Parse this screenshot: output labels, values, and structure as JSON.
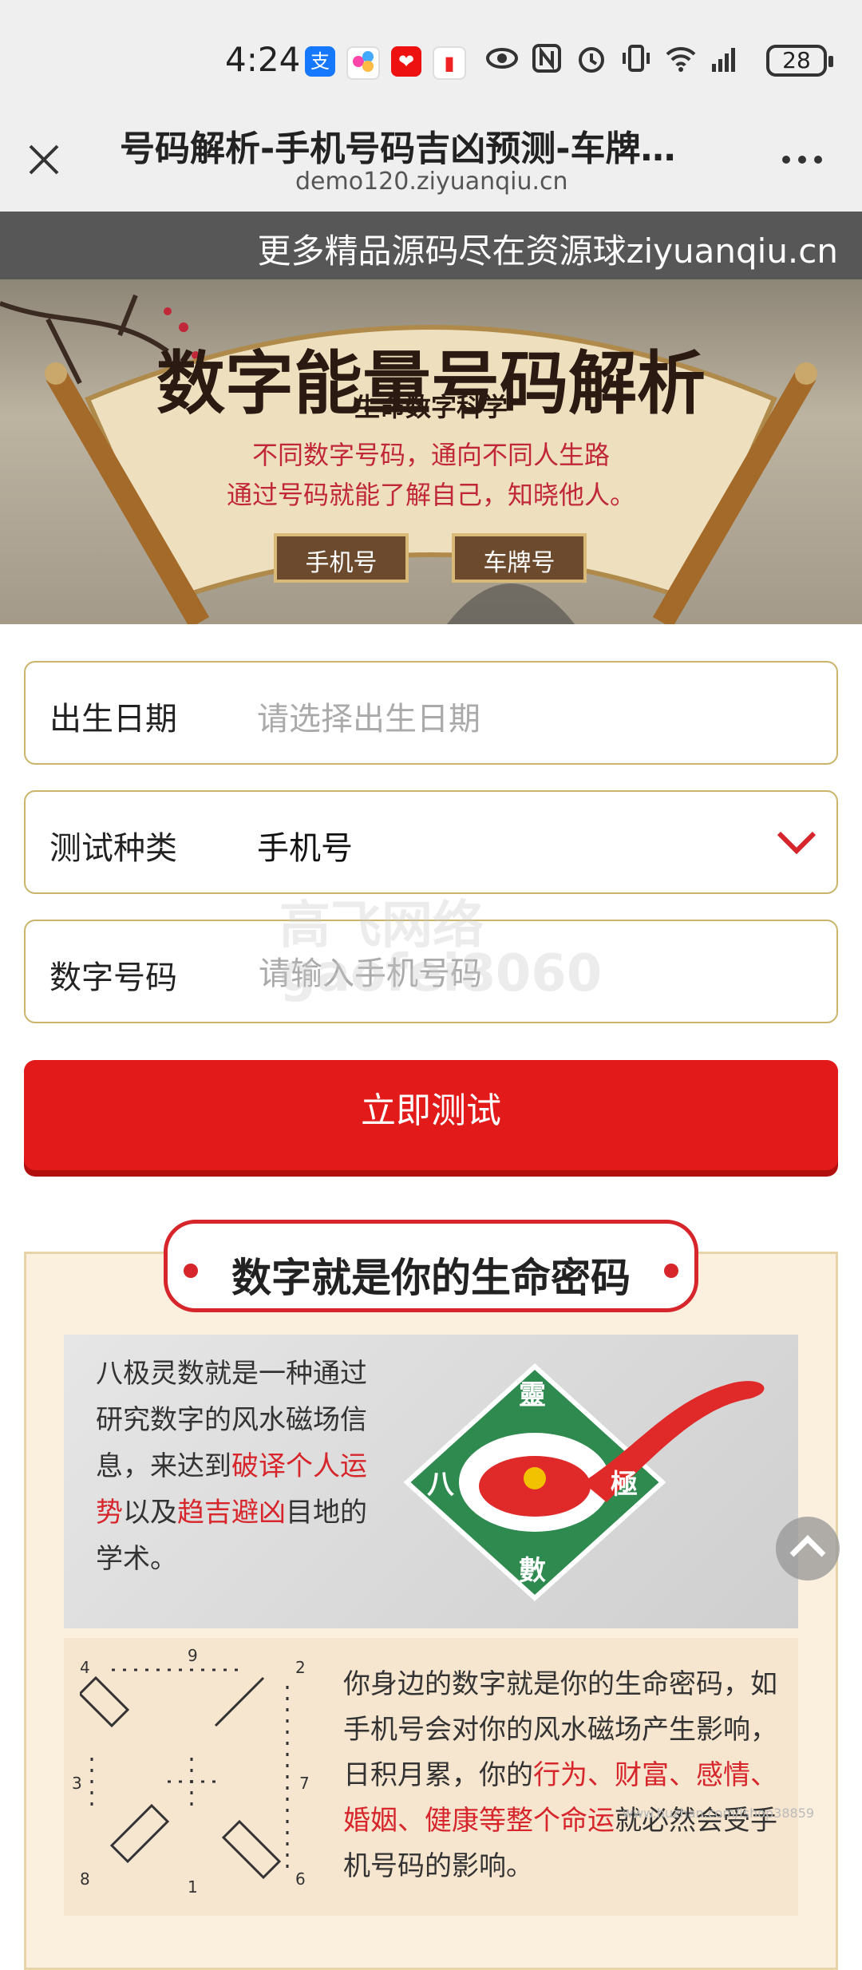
{
  "status_bar": {
    "time": "4:24",
    "battery": "28",
    "apps": [
      "alipay-icon",
      "app-icon",
      "app-icon",
      "app-icon"
    ],
    "indicators": [
      "eye-icon",
      "nfc-icon",
      "alarm-icon",
      "vibrate-icon",
      "wifi-icon",
      "4g-signal-icon"
    ]
  },
  "browser": {
    "title": "号码解析-手机号码吉凶预测-车牌号码吉凶测试-数字能量",
    "url": "demo120.ziyuanqiu.cn"
  },
  "promo": "更多精品源码尽在资源球ziyuanqiu.cn",
  "banner": {
    "title": "数字能量号码解析",
    "subtitle": "生命数字科学",
    "line1": "不同数字号码，通向不同人生路",
    "line2": "通过号码就能了解自己，知晓他人。",
    "tab_phone": "手机号",
    "tab_plate": "车牌号"
  },
  "form": {
    "birth_label": "出生日期",
    "birth_placeholder": "请选择出生日期",
    "type_label": "测试种类",
    "type_value": "手机号",
    "number_label": "数字号码",
    "number_placeholder": "请输入手机号码",
    "submit": "立即测试"
  },
  "watermark": {
    "line1": "高飞网络",
    "line2": "gaofei8060"
  },
  "section": {
    "title": "数字就是你的生命密码",
    "card1": {
      "text_a": "八极灵数就是一种通过研究数字的风水磁场信息，来达到",
      "red_a": "破译个人运势",
      "text_b": "以及",
      "red_b": "趋吉避凶",
      "text_c": "目地的学术。",
      "logo_top": "靈",
      "logo_left": "八",
      "logo_right": "極",
      "logo_bottom": "數"
    },
    "card2": {
      "text_a": "你身边的数字就是你的生命密码，如手机号会对你的风水磁场产生影响，日积月累，你的",
      "red_a": "行为、财富、感情、婚姻、健康等整个命运",
      "text_b": "就必然会受手机号码的影响。",
      "diagram_numbers": [
        "4",
        "9",
        "2",
        "3",
        "7",
        "8",
        "1",
        "6"
      ]
    }
  },
  "corner_watermark": "www.huzhan.com/ishop38859"
}
